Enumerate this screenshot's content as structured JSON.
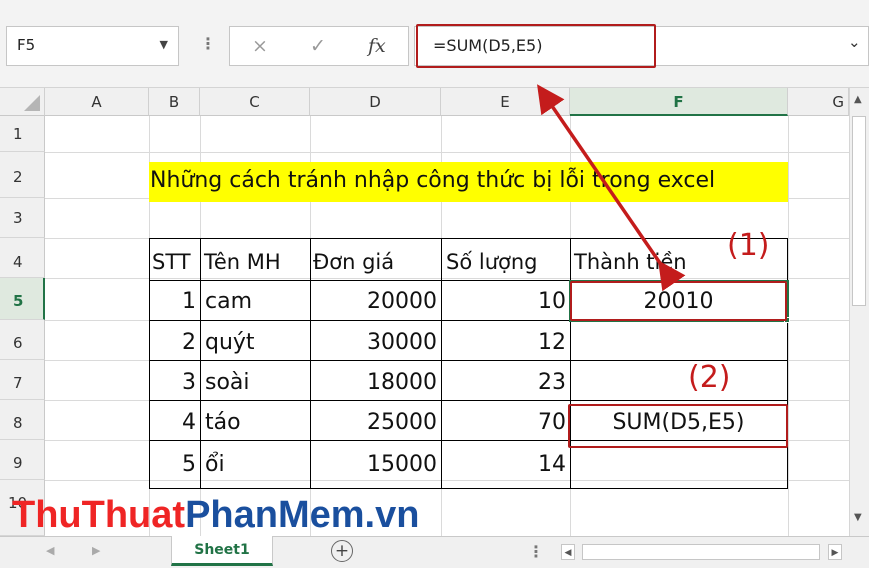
{
  "name_box": "F5",
  "formula_bar": {
    "cancel_icon": "×",
    "enter_icon": "✓",
    "fx_icon": "fx",
    "formula": "=SUM(D5,E5)"
  },
  "columns": [
    "A",
    "B",
    "C",
    "D",
    "E",
    "F",
    "G"
  ],
  "selected_column": "F",
  "rows": [
    "1",
    "2",
    "3",
    "4",
    "5",
    "6",
    "7",
    "8",
    "9",
    "10"
  ],
  "selected_row": "5",
  "sheet": {
    "title": "Những cách tránh nhập công thức bị lỗi trong excel",
    "headers": [
      "STT",
      "Tên MH",
      "Đơn giá",
      "Số lượng",
      "Thành tiền"
    ],
    "data": [
      {
        "stt": "1",
        "name": "cam",
        "price": "20000",
        "qty": "10",
        "total": "20010"
      },
      {
        "stt": "2",
        "name": "quýt",
        "price": "30000",
        "qty": "12",
        "total": ""
      },
      {
        "stt": "3",
        "name": "soài",
        "price": "18000",
        "qty": "23",
        "total": ""
      },
      {
        "stt": "4",
        "name": "táo",
        "price": "25000",
        "qty": "70",
        "total": "SUM(D5,E5)"
      },
      {
        "stt": "5",
        "name": "ổi",
        "price": "15000",
        "qty": "14",
        "total": ""
      }
    ]
  },
  "annotations": {
    "label1": "(1)",
    "label2": "(2)"
  },
  "tabs": {
    "sheet1": "Sheet1",
    "add_sheet": "+"
  },
  "watermark": {
    "part1": "ThuThuat",
    "part2": "PhanMem",
    ".vn": ".vn",
    "part3": ".vn"
  },
  "colors": {
    "accent_green": "#217346",
    "annotation_red": "#b11c1c",
    "highlight_yellow": "#ffff00"
  }
}
